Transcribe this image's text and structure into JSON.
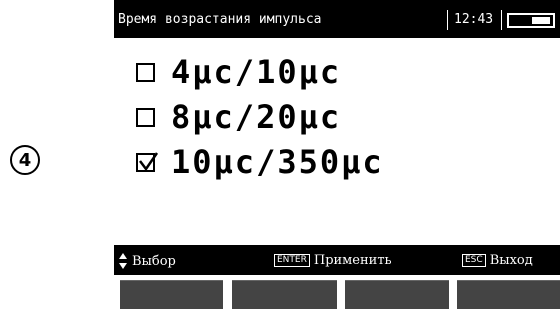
{
  "step_marker": "4",
  "header": {
    "title": "Время возрастания импульса",
    "time": "12:43",
    "battery_icon": "battery-icon"
  },
  "options": [
    {
      "label": "4μc/10μc",
      "checked": false
    },
    {
      "label": "8μc/20μc",
      "checked": false
    },
    {
      "label": "10μc/350μc",
      "checked": true
    }
  ],
  "footer": {
    "select_label": "Выбор",
    "enter_key": "ENTER",
    "apply_label": "Применить",
    "esc_key": "ESC",
    "exit_label": "Выход"
  },
  "colors": {
    "bar": "#000000",
    "softkey": "#444444",
    "background": "#ffffff"
  }
}
